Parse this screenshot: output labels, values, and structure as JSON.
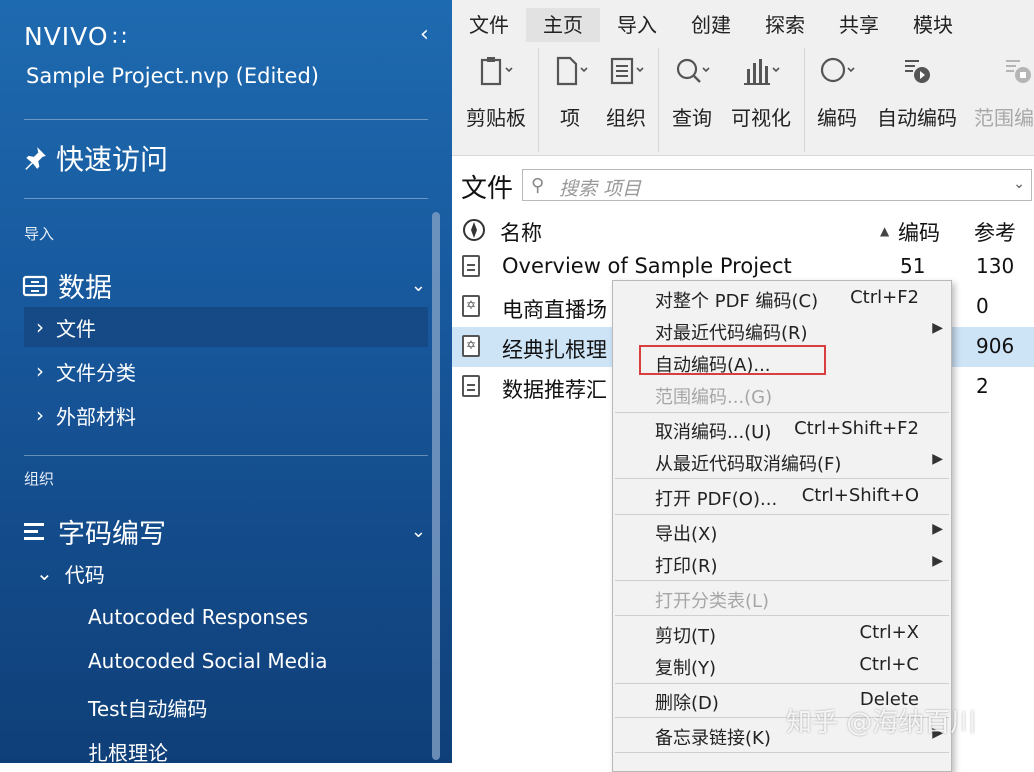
{
  "sidebar": {
    "logo": "NVIVO",
    "logo_mark": "∷",
    "collapse_icon": "‹",
    "project": "Sample Project.nvp (Edited)",
    "quick_access": "快速访问",
    "import_label": "导入",
    "data_section": "数据",
    "data_items": [
      "文件",
      "文件分类",
      "外部材料"
    ],
    "organize_label": "组织",
    "coding_section": "字码编写",
    "codes_label": "代码",
    "codes": [
      "Autocoded Responses",
      "Autocoded Social Media",
      "Test自动编码",
      "扎根理论"
    ]
  },
  "ribbon": {
    "tabs": [
      "文件",
      "主页",
      "导入",
      "创建",
      "探索",
      "共享",
      "模块"
    ],
    "active_tab": "主页",
    "buttons": [
      "剪贴板",
      "项",
      "组织",
      "查询",
      "可视化",
      "编码",
      "自动编码",
      "范围编码"
    ]
  },
  "pane": {
    "title": "文件",
    "search_placeholder": "搜索 项目",
    "columns": {
      "name": "名称",
      "coding": "编码",
      "refs": "参考"
    },
    "rows": [
      {
        "name": "Overview of Sample Project",
        "coding": "51",
        "refs": "130",
        "type": "doc"
      },
      {
        "name": "电商直播场",
        "coding": "",
        "refs": "0",
        "type": "pdf"
      },
      {
        "name": "经典扎根理",
        "coding": "",
        "refs": "906",
        "type": "pdf"
      },
      {
        "name": "数据推荐汇",
        "coding": "",
        "refs": "2",
        "type": "doc"
      }
    ]
  },
  "context_menu": {
    "items": [
      {
        "label": "对整个 PDF 编码(C)",
        "shortcut": "Ctrl+F2"
      },
      {
        "label": "对最近代码编码(R)",
        "shortcut": ""
      },
      {
        "label": "自动编码(A)...",
        "shortcut": ""
      },
      {
        "label": "范围编码...(G)",
        "shortcut": ""
      },
      {
        "label": "取消编码...(U)",
        "shortcut": "Ctrl+Shift+F2"
      },
      {
        "label": "从最近代码取消编码(F)",
        "shortcut": ""
      },
      {
        "label": "打开 PDF(O)...",
        "shortcut": "Ctrl+Shift+O"
      },
      {
        "label": "导出(X)",
        "shortcut": ""
      },
      {
        "label": "打印(R)",
        "shortcut": ""
      },
      {
        "label": "打开分类表(L)",
        "shortcut": ""
      },
      {
        "label": "剪切(T)",
        "shortcut": "Ctrl+X"
      },
      {
        "label": "复制(Y)",
        "shortcut": "Ctrl+C"
      },
      {
        "label": "删除(D)",
        "shortcut": "Delete"
      },
      {
        "label": "备忘录链接(K)",
        "shortcut": ""
      }
    ]
  },
  "watermark": "知乎 @海纳百川",
  "colors": {
    "sidebar": "#17569a",
    "selected_row": "#cde3f6",
    "highlight_box": "#d93f3f"
  }
}
